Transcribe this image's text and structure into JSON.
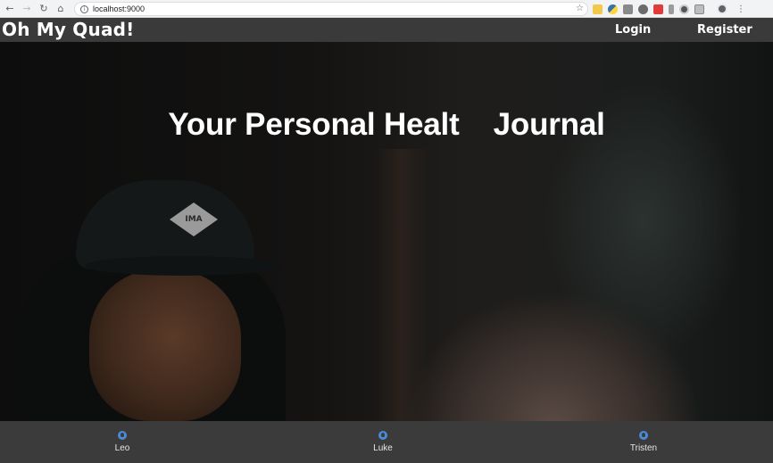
{
  "browser": {
    "url": "localhost:9000",
    "nav_icons": [
      "back-icon",
      "forward-icon",
      "reload-icon",
      "home-icon"
    ],
    "extensions": [
      "note-extension-icon",
      "python-extension-icon",
      "gray-extension-icon",
      "cast-extension-icon",
      "red-extension-icon",
      "puzzle-extension-icon",
      "react-extension-icon",
      "square-extension-icon"
    ]
  },
  "header": {
    "brand": "Oh My Quad!",
    "links": {
      "login": "Login",
      "register": "Register"
    }
  },
  "hero": {
    "title": "Your Personal Healt    Journal",
    "cap_logo_text": "IMA"
  },
  "footer": {
    "credits": [
      {
        "name": "Leo",
        "icon": "github-icon"
      },
      {
        "name": "Luke",
        "icon": "github-icon"
      },
      {
        "name": "Tristen",
        "icon": "github-icon"
      }
    ]
  },
  "colors": {
    "header_bg": "#3a3a3a",
    "footer_bg": "#3b3b3b",
    "github_icon": "#4a8ad8",
    "text": "#ffffff"
  }
}
